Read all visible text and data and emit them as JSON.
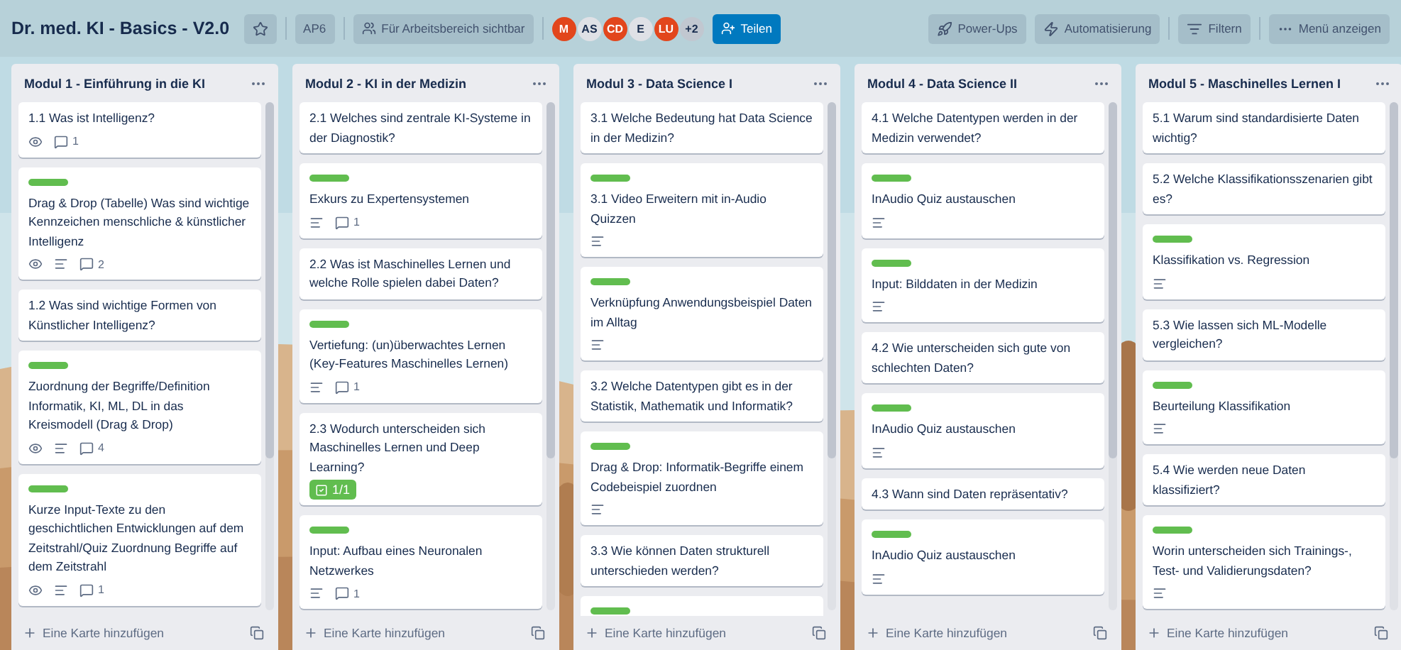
{
  "board": {
    "title": "Dr. med. KI - Basics - V2.0",
    "starred": false,
    "workspace": "AP6",
    "visibility": "Für Arbeitsbereich sichtbar",
    "members": [
      {
        "initials": "M",
        "color": "#e2461c"
      },
      {
        "initials": "AS",
        "color": "#dfe1e6"
      },
      {
        "initials": "CD",
        "color": "#e2461c"
      },
      {
        "initials": "E",
        "color": "#dfe1e6"
      },
      {
        "initials": "LU",
        "color": "#e2461c"
      },
      {
        "initials": "+2",
        "color": "#c1c7d0"
      }
    ],
    "share": "Teilen",
    "actions": [
      {
        "kind": "powerups",
        "label": "Power-Ups"
      },
      {
        "kind": "automation",
        "label": "Automatisierung"
      },
      {
        "kind": "filter",
        "label": "Filtern"
      },
      {
        "kind": "menu",
        "label": "Menü anzeigen"
      }
    ]
  },
  "lists": [
    {
      "title": "Modul 1 - Einführung in die KI",
      "add_card": "Eine Karte hinzufügen",
      "cards": [
        {
          "label": false,
          "title": "1.1 Was ist Intelligenz?",
          "watched": true,
          "description": false,
          "comments": "1"
        },
        {
          "label": true,
          "title": "Drag & Drop (Tabelle) Was sind wichtige Kennzeichen menschliche & künstlicher Intelligenz",
          "watched": true,
          "description": true,
          "comments": "2"
        },
        {
          "label": false,
          "title": "1.2 Was sind wichtige Formen von Künstlicher Intelligenz?",
          "watched": false,
          "description": false
        },
        {
          "label": true,
          "title": "Zuordnung der Begriffe/Definition Informatik, KI, ML, DL in das Kreismodell (Drag & Drop)",
          "watched": true,
          "description": true,
          "comments": "4"
        },
        {
          "label": true,
          "title": "Kurze Input-Texte zu den geschichtlichen Entwicklungen auf dem Zeitstrahl/Quiz Zuordnung Begriffe auf dem Zeitstrahl",
          "watched": true,
          "description": true,
          "comments": "1"
        }
      ]
    },
    {
      "title": "Modul 2 - KI in der Medizin",
      "add_card": "Eine Karte hinzufügen",
      "cards": [
        {
          "label": false,
          "title": "2.1 Welches sind zentrale KI-Systeme in der Diagnostik?",
          "watched": false,
          "description": false
        },
        {
          "label": true,
          "title": "Exkurs zu Expertensystemen",
          "watched": false,
          "description": true,
          "comments": "1"
        },
        {
          "label": false,
          "title": "2.2 Was ist Maschinelles Lernen und welche Rolle spielen dabei Daten?",
          "watched": false,
          "description": false
        },
        {
          "label": true,
          "title": "Vertiefung: (un)überwachtes Lernen (Key-Features Maschinelles Lernen)",
          "watched": false,
          "description": true,
          "comments": "1"
        },
        {
          "label": false,
          "title": "2.3 Wodurch unterscheiden sich Maschinelles Lernen und Deep Learning?",
          "watched": false,
          "description": false,
          "checklist": "1/1"
        },
        {
          "label": true,
          "title": "Input: Aufbau eines Neuronalen Netzwerkes",
          "watched": false,
          "description": true,
          "comments": "1"
        }
      ]
    },
    {
      "title": "Modul 3 - Data Science I",
      "add_card": "Eine Karte hinzufügen",
      "cards": [
        {
          "label": false,
          "title": "3.1 Welche Bedeutung hat Data Science in der Medizin?",
          "watched": false,
          "description": false
        },
        {
          "label": true,
          "title": "3.1 Video Erweitern mit in-Audio Quizzen",
          "watched": false,
          "description": true
        },
        {
          "label": true,
          "title": "Verknüpfung Anwendungsbeispiel Daten im Alltag",
          "watched": false,
          "description": true
        },
        {
          "label": false,
          "title": "3.2 Welche Datentypen gibt es in der Statistik, Mathematik und Informatik?",
          "watched": false,
          "description": false
        },
        {
          "label": true,
          "title": "Drag & Drop: Informatik-Begriffe einem Codebeispiel zuordnen",
          "watched": false,
          "description": true
        },
        {
          "label": false,
          "title": "3.3 Wie können Daten strukturell unterschieden werden?",
          "watched": false,
          "description": false
        },
        {
          "label": true,
          "watched": false,
          "description": false
        }
      ]
    },
    {
      "title": "Modul 4 - Data Science II",
      "add_card": "Eine Karte hinzufügen",
      "cards": [
        {
          "label": false,
          "title": "4.1 Welche Datentypen werden in der Medizin verwendet?",
          "watched": false,
          "description": false
        },
        {
          "label": true,
          "title": "InAudio Quiz austauschen",
          "watched": false,
          "description": true
        },
        {
          "label": true,
          "title": "Input: Bilddaten in der Medizin",
          "watched": false,
          "description": true
        },
        {
          "label": false,
          "title": "4.2 Wie unterscheiden sich gute von schlechten Daten?",
          "watched": false,
          "description": false
        },
        {
          "label": true,
          "title": "InAudio Quiz austauschen",
          "watched": false,
          "description": true
        },
        {
          "label": false,
          "title": "4.3 Wann sind Daten repräsentativ?",
          "watched": false,
          "description": false
        },
        {
          "label": true,
          "title": "InAudio Quiz austauschen",
          "watched": false,
          "description": true
        }
      ]
    },
    {
      "title": "Modul 5 - Maschinelles Lernen I",
      "add_card": "Eine Karte hinzufügen",
      "cards": [
        {
          "label": false,
          "title": "5.1 Warum sind standardisierte Daten wichtig?",
          "watched": false,
          "description": false
        },
        {
          "label": false,
          "title": "5.2 Welche Klassifikationsszenarien gibt es?",
          "watched": false,
          "description": false
        },
        {
          "label": true,
          "title": "Klassifikation vs. Regression",
          "watched": false,
          "description": true
        },
        {
          "label": false,
          "title": "5.3 Wie lassen sich ML-Modelle vergleichen?",
          "watched": false,
          "description": false
        },
        {
          "label": true,
          "title": "Beurteilung Klassifikation",
          "watched": false,
          "description": true
        },
        {
          "label": false,
          "title": "5.4 Wie werden neue Daten klassifiziert?",
          "watched": false,
          "description": false
        },
        {
          "label": true,
          "title": "Worin unterscheiden sich Trainings-, Test- und Validierungsdaten?",
          "watched": false,
          "description": true
        }
      ]
    }
  ]
}
